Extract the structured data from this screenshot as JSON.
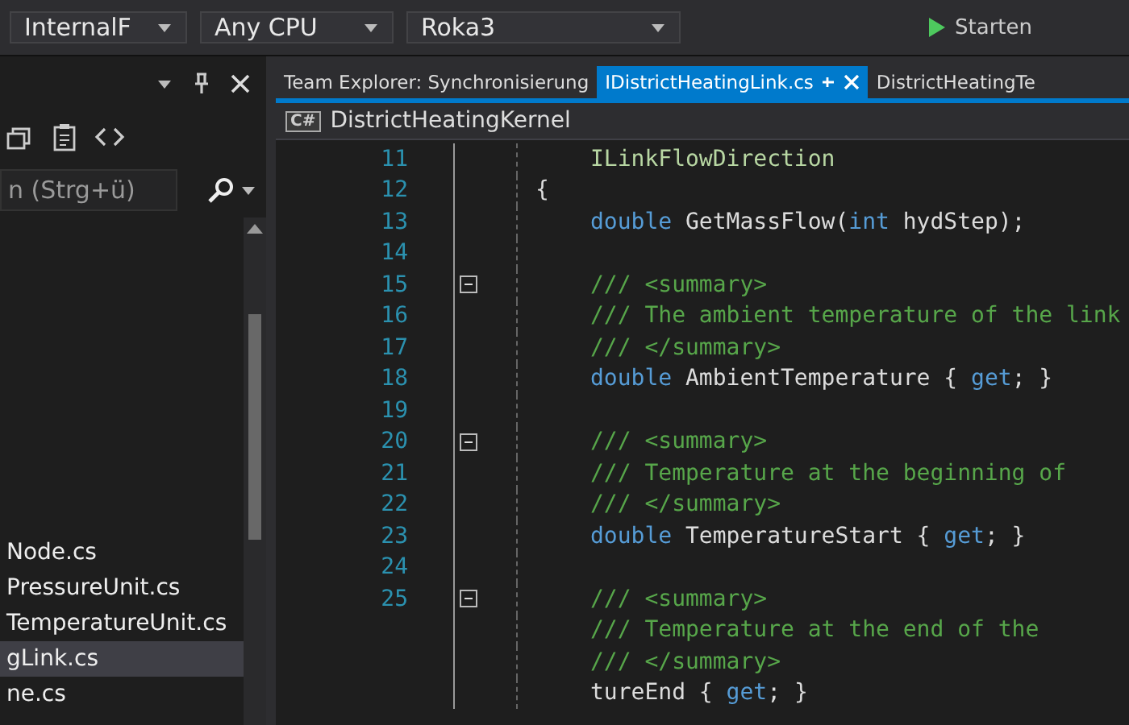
{
  "toolbar": {
    "dropdowns": [
      "InternalF",
      "Any CPU",
      "Roka3"
    ],
    "run_button": "Starten"
  },
  "side_panel": {
    "search": {
      "placeholder": "n (Strg+ü)"
    },
    "files": [
      {
        "name": "Node.cs",
        "selected": false
      },
      {
        "name": "PressureUnit.cs",
        "selected": false
      },
      {
        "name": "TemperatureUnit.cs",
        "selected": false
      },
      {
        "name": "gLink.cs",
        "selected": true
      },
      {
        "name": "ne.cs",
        "selected": false
      }
    ]
  },
  "editor": {
    "tabs": [
      {
        "label": "Team Explorer: Synchronisierung",
        "selected": false
      },
      {
        "label": "IDistrictHeatingLink.cs",
        "selected": true
      },
      {
        "label": "DistrictHeatingTe",
        "selected": false
      }
    ],
    "nav_badge": "C#",
    "nav_project": "DistrictHeatingKernel",
    "lines": [
      {
        "number": "11",
        "kind": "member",
        "fold_marker": false,
        "segments": [
          {
            "kind": "type",
            "text": "ILinkFlowDirection"
          }
        ]
      },
      {
        "number": "12",
        "kind": "brace",
        "fold_marker": false,
        "segments": [
          {
            "kind": "plain",
            "text": "{"
          }
        ]
      },
      {
        "number": "13",
        "kind": "member",
        "fold_marker": false,
        "segments": [
          {
            "kind": "keyword",
            "text": "double"
          },
          {
            "kind": "plain",
            "text": " GetMassFlow("
          },
          {
            "kind": "keyword",
            "text": "int"
          },
          {
            "kind": "plain",
            "text": " hydStep);"
          }
        ]
      },
      {
        "number": "14",
        "kind": "blank",
        "fold_marker": false
      },
      {
        "number": "15",
        "kind": "member",
        "fold_marker": true,
        "segments": [
          {
            "kind": "comment",
            "text": "/// <summary>"
          }
        ]
      },
      {
        "number": "16",
        "kind": "member",
        "fold_marker": false,
        "segments": [
          {
            "kind": "comment",
            "text": "/// The ambient temperature of the link"
          }
        ]
      },
      {
        "number": "17",
        "kind": "member",
        "fold_marker": false,
        "segments": [
          {
            "kind": "comment",
            "text": "/// </summary>"
          }
        ]
      },
      {
        "number": "18",
        "kind": "member",
        "fold_marker": false,
        "segments": [
          {
            "kind": "keyword",
            "text": "double"
          },
          {
            "kind": "plain",
            "text": " AmbientTemperature { "
          },
          {
            "kind": "keyword",
            "text": "get"
          },
          {
            "kind": "plain",
            "text": "; }"
          }
        ]
      },
      {
        "number": "19",
        "kind": "blank",
        "fold_marker": false
      },
      {
        "number": "20",
        "kind": "member",
        "fold_marker": true,
        "segments": [
          {
            "kind": "comment",
            "text": "/// <summary>"
          }
        ]
      },
      {
        "number": "21",
        "kind": "member",
        "fold_marker": false,
        "segments": [
          {
            "kind": "comment",
            "text": "/// Temperature at the beginning of"
          }
        ]
      },
      {
        "number": "22",
        "kind": "member",
        "fold_marker": false,
        "segments": [
          {
            "kind": "comment",
            "text": "/// </summary>"
          }
        ]
      },
      {
        "number": "23",
        "kind": "member",
        "fold_marker": false,
        "segments": [
          {
            "kind": "keyword",
            "text": "double"
          },
          {
            "kind": "plain",
            "text": " TemperatureStart { "
          },
          {
            "kind": "keyword",
            "text": "get"
          },
          {
            "kind": "plain",
            "text": "; }"
          }
        ]
      },
      {
        "number": "24",
        "kind": "blank",
        "fold_marker": false
      },
      {
        "number": "25",
        "kind": "member",
        "fold_marker": true,
        "segments": [
          {
            "kind": "comment",
            "text": "/// <summary>"
          }
        ]
      },
      {
        "kind": "member",
        "fold_marker": false,
        "segments": [
          {
            "kind": "comment",
            "text": "/// Temperature at the end of the"
          }
        ]
      },
      {
        "kind": "member",
        "fold_marker": false,
        "segments": [
          {
            "kind": "comment",
            "text": "/// </summary>"
          }
        ]
      },
      {
        "kind": "member",
        "fold_marker": false,
        "segments": [
          {
            "kind": "plain",
            "text": "tureEnd { "
          },
          {
            "kind": "keyword",
            "text": "get"
          },
          {
            "kind": "plain",
            "text": "; }"
          }
        ]
      }
    ]
  }
}
